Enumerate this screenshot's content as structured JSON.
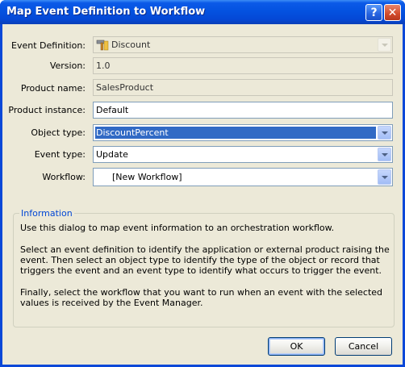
{
  "window": {
    "title": "Map Event Definition to Workflow",
    "help_button": "?",
    "close_button": "✕"
  },
  "form": {
    "event_definition": {
      "label": "Event Definition:",
      "value": "Discount",
      "icon": "hammer-icon"
    },
    "version": {
      "label": "Version:",
      "value": "1.0"
    },
    "product_name": {
      "label": "Product name:",
      "value": "SalesProduct"
    },
    "product_instance": {
      "label": "Product instance:",
      "value": "Default"
    },
    "object_type": {
      "label": "Object type:",
      "value": "DiscountPercent"
    },
    "event_type": {
      "label": "Event type:",
      "value": "Update"
    },
    "workflow": {
      "label": "Workflow:",
      "value": "[New Workflow]"
    }
  },
  "info": {
    "legend": "Information",
    "p1": "Use this dialog to map event information to an orchestration workflow.",
    "p2": "Select an event definition to identify the application or external product raising the event. Then select an object type to identify the type of the object or record that triggers the event and an event type to identify what occurs to trigger the event.",
    "p3": "Finally, select the workflow that you want to run when an event with the selected values is received by the Event Manager."
  },
  "buttons": {
    "ok": "OK",
    "cancel": "Cancel"
  },
  "colors": {
    "titlebar": "#0452e0",
    "selection": "#316ac5",
    "dialog_bg": "#ece9d8",
    "info_legend": "#0046d5"
  }
}
